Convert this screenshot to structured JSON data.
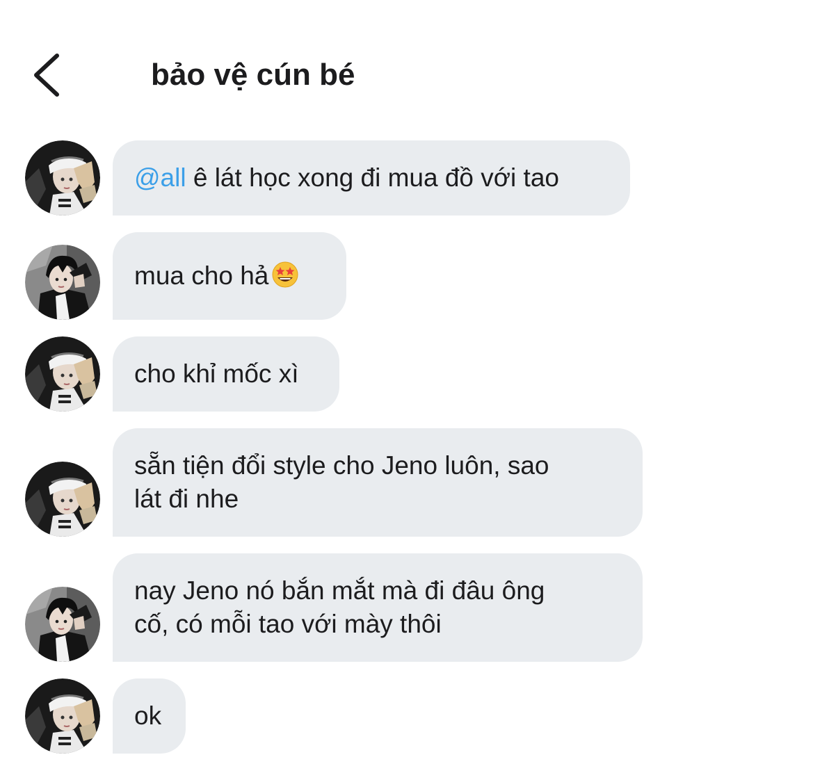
{
  "header": {
    "back_icon": "chevron-left-icon",
    "title": "bảo vệ cún bé"
  },
  "messages": [
    {
      "sender": "avatar-a",
      "mention": "@all",
      "text": "ê lát học xong đi mua đồ với tao"
    },
    {
      "sender": "avatar-b",
      "text": "mua cho hả",
      "emoji": "star-struck-emoji-icon"
    },
    {
      "sender": "avatar-a",
      "text": "cho khỉ mốc xì"
    },
    {
      "sender": "avatar-a",
      "text": "sẵn tiện đổi style cho Jeno luôn, sao\nlát đi nhe"
    },
    {
      "sender": "avatar-b",
      "text": "nay Jeno nó bắn mắt mà đi đâu ông\ncố, có mỗi tao với mày thôi"
    },
    {
      "sender": "avatar-a",
      "text": "ok"
    }
  ],
  "colors": {
    "bubble_background": "#e9ecef",
    "mention": "#3b9fe8",
    "text": "#1c1c1e"
  }
}
